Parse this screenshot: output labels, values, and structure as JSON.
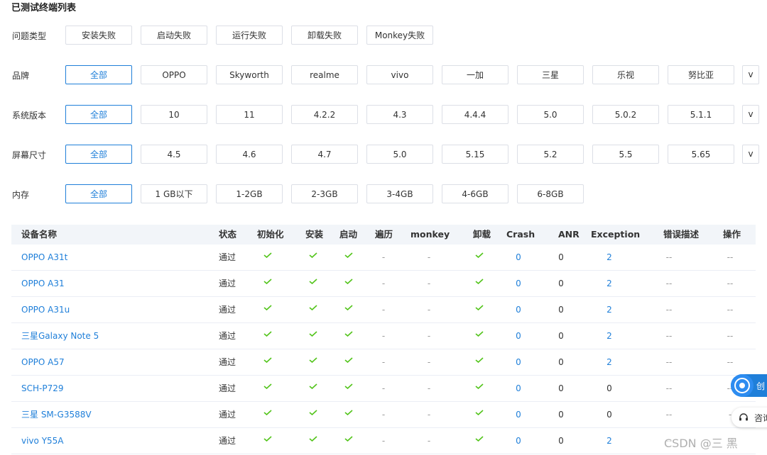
{
  "title": "已测试终端列表",
  "filters": {
    "problem_type": {
      "label": "问题类型",
      "options": [
        "安装失败",
        "启动失败",
        "运行失败",
        "卸载失败",
        "Monkey失败"
      ]
    },
    "brand": {
      "label": "品牌",
      "options": [
        "全部",
        "OPPO",
        "Skyworth",
        "realme",
        "vivo",
        "一加",
        "三星",
        "乐视",
        "努比亚"
      ],
      "more": "v"
    },
    "os_version": {
      "label": "系统版本",
      "options": [
        "全部",
        "10",
        "11",
        "4.2.2",
        "4.3",
        "4.4.4",
        "5.0",
        "5.0.2",
        "5.1.1"
      ],
      "more": "v"
    },
    "screen_size": {
      "label": "屏幕尺寸",
      "options": [
        "全部",
        "4.5",
        "4.6",
        "4.7",
        "5.0",
        "5.15",
        "5.2",
        "5.5",
        "5.65"
      ],
      "more": "v"
    },
    "memory": {
      "label": "内存",
      "options": [
        "全部",
        "1 GB以下",
        "1-2GB",
        "2-3GB",
        "3-4GB",
        "4-6GB",
        "6-8GB"
      ]
    }
  },
  "table": {
    "headers": [
      "设备名称",
      "状态",
      "初始化",
      "安装",
      "启动",
      "遍历",
      "monkey",
      "卸载",
      "Crash",
      "ANR",
      "Exception",
      "错误描述",
      "操作"
    ],
    "rows": [
      {
        "name": "OPPO A31t",
        "status": "通过",
        "init": true,
        "install": true,
        "launch": true,
        "traverse": "-",
        "monkey": "-",
        "uninstall": true,
        "crash": "0",
        "anr": "0",
        "exception": "2",
        "error": "--",
        "action": "--"
      },
      {
        "name": "OPPO A31",
        "status": "通过",
        "init": true,
        "install": true,
        "launch": true,
        "traverse": "-",
        "monkey": "-",
        "uninstall": true,
        "crash": "0",
        "anr": "0",
        "exception": "2",
        "error": "--",
        "action": "--"
      },
      {
        "name": "OPPO A31u",
        "status": "通过",
        "init": true,
        "install": true,
        "launch": true,
        "traverse": "-",
        "monkey": "-",
        "uninstall": true,
        "crash": "0",
        "anr": "0",
        "exception": "2",
        "error": "--",
        "action": "--"
      },
      {
        "name": "三星Galaxy Note 5",
        "status": "通过",
        "init": true,
        "install": true,
        "launch": true,
        "traverse": "-",
        "monkey": "-",
        "uninstall": true,
        "crash": "0",
        "anr": "0",
        "exception": "2",
        "error": "--",
        "action": "--"
      },
      {
        "name": "OPPO A57",
        "status": "通过",
        "init": true,
        "install": true,
        "launch": true,
        "traverse": "-",
        "monkey": "-",
        "uninstall": true,
        "crash": "0",
        "anr": "0",
        "exception": "2",
        "error": "--",
        "action": "--"
      },
      {
        "name": "SCH-P729",
        "status": "通过",
        "init": true,
        "install": true,
        "launch": true,
        "traverse": "-",
        "monkey": "-",
        "uninstall": true,
        "crash": "0",
        "anr": "0",
        "exception": "0",
        "error": "--",
        "action": "--"
      },
      {
        "name": "三星 SM-G3588V",
        "status": "通过",
        "init": true,
        "install": true,
        "launch": true,
        "traverse": "-",
        "monkey": "-",
        "uninstall": true,
        "crash": "0",
        "anr": "0",
        "exception": "0",
        "error": "--",
        "action": "-"
      },
      {
        "name": "vivo Y55A",
        "status": "通过",
        "init": true,
        "install": true,
        "launch": true,
        "traverse": "-",
        "monkey": "-",
        "uninstall": true,
        "crash": "0",
        "anr": "0",
        "exception": "2",
        "error": "--",
        "action": "-"
      }
    ]
  },
  "widgets": {
    "create_text": "创",
    "help_text": "咨询",
    "watermark": "CSDN @三 黑"
  },
  "colors": {
    "accent": "#1f7fd9",
    "check": "#52c41a",
    "header_bg": "#f2f5f9"
  },
  "icons": {
    "check": "check-icon",
    "more": "chevron-down-icon",
    "help": "headset-icon",
    "create": "gear-icon"
  }
}
